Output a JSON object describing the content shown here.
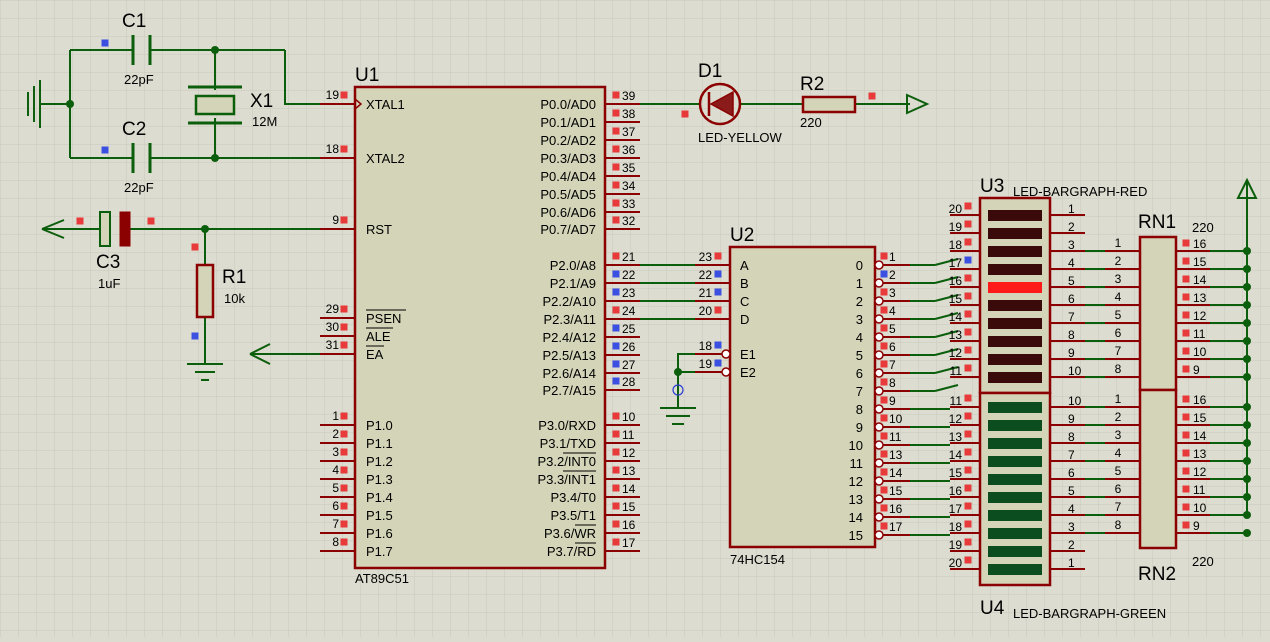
{
  "colors": {
    "background": "#dcdcd0",
    "grid": "#c9c9bc",
    "body_fill": "#d4d4b8",
    "outline": "#8b0000",
    "wire": "#0b5e0b",
    "pin_marker_red": "#e83a3a",
    "pin_marker_blue": "#3b4fe0",
    "led_red_off": "#3a0a0a",
    "led_red_on": "#ff1a1a",
    "led_green": "#0b4d1e"
  },
  "u1": {
    "ref": "U1",
    "part": "AT89C51",
    "left_pins": [
      {
        "num": "19",
        "name": "XTAL1"
      },
      {
        "num": "18",
        "name": "XTAL2"
      },
      {
        "num": "9",
        "name": "RST"
      },
      {
        "num": "29",
        "name": "PSEN"
      },
      {
        "num": "30",
        "name": "ALE"
      },
      {
        "num": "31",
        "name": "EA"
      },
      {
        "num": "1",
        "name": "P1.0"
      },
      {
        "num": "2",
        "name": "P1.1"
      },
      {
        "num": "3",
        "name": "P1.2"
      },
      {
        "num": "4",
        "name": "P1.3"
      },
      {
        "num": "5",
        "name": "P1.4"
      },
      {
        "num": "6",
        "name": "P1.5"
      },
      {
        "num": "7",
        "name": "P1.6"
      },
      {
        "num": "8",
        "name": "P1.7"
      }
    ],
    "right_pins": [
      {
        "num": "39",
        "name": "P0.0/AD0"
      },
      {
        "num": "38",
        "name": "P0.1/AD1"
      },
      {
        "num": "37",
        "name": "P0.2/AD2"
      },
      {
        "num": "36",
        "name": "P0.3/AD3"
      },
      {
        "num": "35",
        "name": "P0.4/AD4"
      },
      {
        "num": "34",
        "name": "P0.5/AD5"
      },
      {
        "num": "33",
        "name": "P0.6/AD6"
      },
      {
        "num": "32",
        "name": "P0.7/AD7"
      },
      {
        "num": "21",
        "name": "P2.0/A8"
      },
      {
        "num": "22",
        "name": "P2.1/A9"
      },
      {
        "num": "23",
        "name": "P2.2/A10"
      },
      {
        "num": "24",
        "name": "P2.3/A11"
      },
      {
        "num": "25",
        "name": "P2.4/A12"
      },
      {
        "num": "26",
        "name": "P2.5/A13"
      },
      {
        "num": "27",
        "name": "P2.6/A14"
      },
      {
        "num": "28",
        "name": "P2.7/A15"
      },
      {
        "num": "10",
        "name": "P3.0/RXD"
      },
      {
        "num": "11",
        "name": "P3.1/TXD"
      },
      {
        "num": "12",
        "name": "P3.2/INT0"
      },
      {
        "num": "13",
        "name": "P3.3/INT1"
      },
      {
        "num": "14",
        "name": "P3.4/T0"
      },
      {
        "num": "15",
        "name": "P3.5/T1"
      },
      {
        "num": "16",
        "name": "P3.6/WR"
      },
      {
        "num": "17",
        "name": "P3.7/RD"
      }
    ]
  },
  "u2": {
    "ref": "U2",
    "part": "74HC154",
    "inputs": [
      {
        "num": "23",
        "name": "A"
      },
      {
        "num": "22",
        "name": "B"
      },
      {
        "num": "21",
        "name": "C"
      },
      {
        "num": "20",
        "name": "D"
      }
    ],
    "enables": [
      {
        "num": "18",
        "name": "E1"
      },
      {
        "num": "19",
        "name": "E2"
      }
    ],
    "outputs": [
      {
        "name": "0",
        "num": "1"
      },
      {
        "name": "1",
        "num": "2"
      },
      {
        "name": "2",
        "num": "3"
      },
      {
        "name": "3",
        "num": "4"
      },
      {
        "name": "4",
        "num": "5"
      },
      {
        "name": "5",
        "num": "6"
      },
      {
        "name": "6",
        "num": "7"
      },
      {
        "name": "7",
        "num": "8"
      },
      {
        "name": "8",
        "num": "9"
      },
      {
        "name": "9",
        "num": "10"
      },
      {
        "name": "10",
        "num": "11"
      },
      {
        "name": "11",
        "num": "13"
      },
      {
        "name": "12",
        "num": "14"
      },
      {
        "name": "13",
        "num": "15"
      },
      {
        "name": "14",
        "num": "16"
      },
      {
        "name": "15",
        "num": "17"
      }
    ]
  },
  "u3": {
    "ref": "U3",
    "part": "LED-BARGRAPH-RED",
    "left_nums": [
      "20",
      "19",
      "18",
      "17",
      "16",
      "15",
      "14",
      "13",
      "12",
      "11"
    ],
    "right_nums": [
      "1",
      "2",
      "3",
      "4",
      "5",
      "6",
      "7",
      "8",
      "9",
      "10"
    ],
    "lit_segment": 4
  },
  "u4": {
    "ref": "U4",
    "part": "LED-BARGRAPH-GREEN",
    "left_nums": [
      "11",
      "12",
      "13",
      "14",
      "15",
      "16",
      "17",
      "18",
      "19",
      "20"
    ],
    "right_nums": [
      "10",
      "9",
      "8",
      "7",
      "6",
      "5",
      "4",
      "3",
      "2",
      "1"
    ]
  },
  "rn1": {
    "ref": "RN1",
    "value": "220",
    "left_nums": [
      "1",
      "2",
      "3",
      "4",
      "5",
      "6",
      "7",
      "8"
    ],
    "right_nums": [
      "16",
      "15",
      "14",
      "13",
      "12",
      "11",
      "10",
      "9"
    ]
  },
  "rn2": {
    "ref": "RN2",
    "value": "220",
    "left_nums": [
      "1",
      "2",
      "3",
      "4",
      "5",
      "6",
      "7",
      "8"
    ],
    "right_nums": [
      "16",
      "15",
      "14",
      "13",
      "12",
      "11",
      "10",
      "9"
    ]
  },
  "c1": {
    "ref": "C1",
    "value": "22pF"
  },
  "c2": {
    "ref": "C2",
    "value": "22pF"
  },
  "c3": {
    "ref": "C3",
    "value": "1uF"
  },
  "x1": {
    "ref": "X1",
    "value": "12M"
  },
  "r1": {
    "ref": "R1",
    "value": "10k"
  },
  "r2": {
    "ref": "R2",
    "value": "220"
  },
  "d1": {
    "ref": "D1",
    "value": "LED-YELLOW"
  }
}
